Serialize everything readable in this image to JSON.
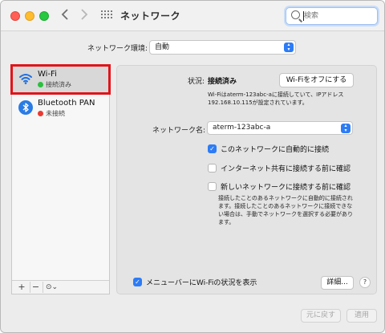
{
  "window": {
    "title": "ネットワーク"
  },
  "search": {
    "placeholder": "検索"
  },
  "location": {
    "label": "ネットワーク環境:",
    "value": "自動"
  },
  "sidebar": {
    "items": [
      {
        "name": "Wi-Fi",
        "status": "接続済み",
        "status_color": "#2bbf3f",
        "selected": true
      },
      {
        "name": "Bluetooth PAN",
        "status": "未接続",
        "status_color": "#ec3a32",
        "selected": false
      }
    ],
    "tools": {
      "add": "+",
      "remove": "−",
      "action": "⊙⌄"
    }
  },
  "detail": {
    "status_label": "状況:",
    "status_value": "接続済み",
    "wifi_off_button": "Wi-Fiをオフにする",
    "status_description": "Wi-Fiはaterm-123abc-aに接続していて、IPアドレス 192.168.10.115が設定されています。",
    "network_name_label": "ネットワーク名:",
    "network_name_value": "aterm-123abc-a",
    "options": [
      {
        "label": "このネットワークに自動的に接続",
        "checked": true
      },
      {
        "label": "インターネット共有に接続する前に確認",
        "checked": false
      },
      {
        "label": "新しいネットワークに接続する前に確認",
        "checked": false
      }
    ],
    "join_description": "接続したことのあるネットワークに自動的に接続されます。接続したことのあるネットワークに接続できない場合は、手動でネットワークを選択する必要があります。",
    "menubar_label": "メニューバーにWi-Fiの状況を表示",
    "menubar_checked": true,
    "advanced_button": "詳細...",
    "help_button": "?"
  },
  "footer": {
    "revert_button": "元に戻す",
    "apply_button": "適用"
  },
  "colors": {
    "accent": "#2d7cf6",
    "selection_outline": "#e0141a"
  }
}
